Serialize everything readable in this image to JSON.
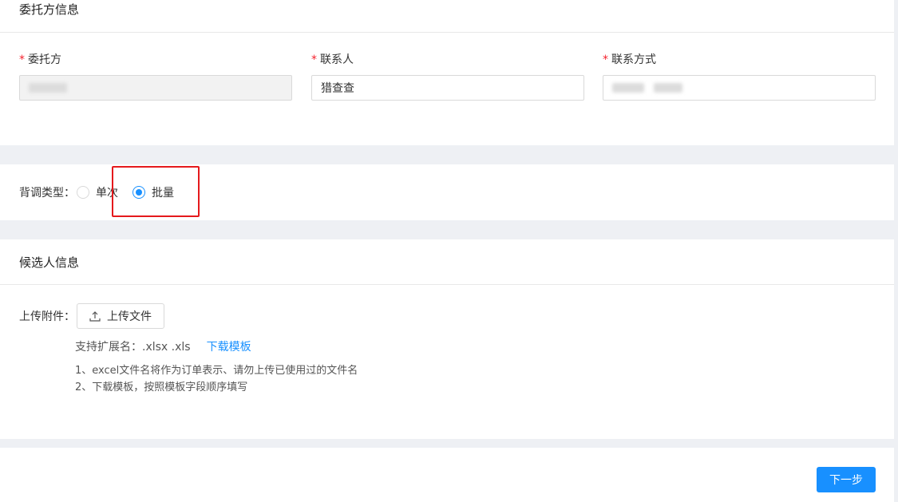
{
  "client_section": {
    "title": "委托方信息",
    "fields": [
      {
        "label": "委托方",
        "required": true,
        "value": "",
        "redacted": true,
        "disabled": true
      },
      {
        "label": "联系人",
        "required": true,
        "value": "猎查查",
        "redacted": false,
        "disabled": false
      },
      {
        "label": "联系方式",
        "required": true,
        "value": "",
        "redacted": true,
        "disabled": false
      }
    ],
    "required_mark": "*"
  },
  "check_type": {
    "label": "背调类型：",
    "options": [
      {
        "label": "单次",
        "checked": false
      },
      {
        "label": "批量",
        "checked": true
      }
    ],
    "highlight_color": "#e5191c"
  },
  "candidate_section": {
    "title": "候选人信息",
    "upload_label": "上传附件：",
    "upload_button": "上传文件",
    "extensions_hint": "支持扩展名：.xlsx .xls",
    "download_template": "下载模板",
    "notes": [
      "1、excel文件名将作为订单表示、请勿上传已使用过的文件名",
      "2、下载模板，按照模板字段顺序填写"
    ]
  },
  "footer": {
    "next_button": "下一步"
  },
  "colors": {
    "accent": "#1890ff",
    "required": "#f5222d",
    "background": "#eef0f4"
  }
}
